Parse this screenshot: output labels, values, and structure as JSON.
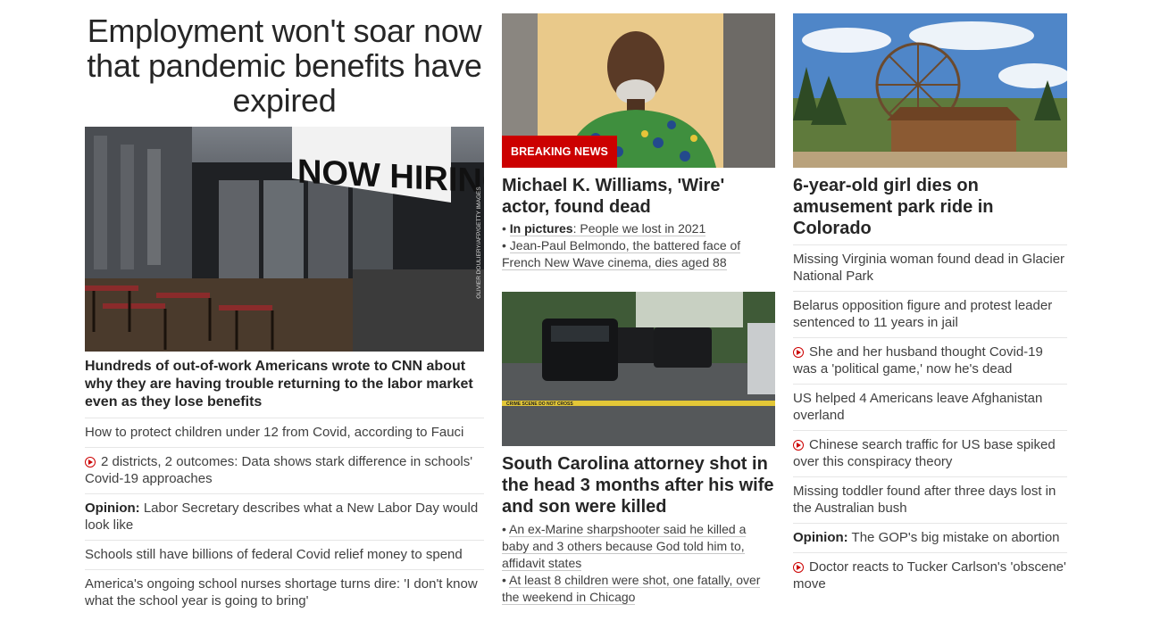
{
  "col1": {
    "headline": "Employment won't soar now that pandemic benefits have expired",
    "image_credit": "OLIVIER DOULIERY/AFP/GETTY IMAGES",
    "image_sign": "NOW HIRING",
    "caption": "Hundreds of out-of-work Americans wrote to CNN about why they are having trouble returning to the labor market even as they lose benefits",
    "items": [
      {
        "label": "",
        "text": "How to protect children under 12 from Covid, according to Fauci",
        "video": false
      },
      {
        "label": "",
        "text": "2 districts, 2 outcomes: Data shows stark difference in schools' Covid-19 approaches",
        "video": true
      },
      {
        "label": "Opinion:",
        "text": " Labor Secretary describes what a New Labor Day would look like",
        "video": false
      },
      {
        "label": "",
        "text": "Schools still have billions of federal Covid relief money to spend",
        "video": false
      },
      {
        "label": "",
        "text": "America's ongoing school nurses shortage turns dire: 'I don't know what the school year is going to bring'",
        "video": false
      }
    ]
  },
  "col2": {
    "card1": {
      "badge": "BREAKING NEWS",
      "title": "Michael K. Williams, 'Wire' actor, found dead",
      "bullets": [
        {
          "label": "In pictures",
          "text": ": People we lost in 2021"
        },
        {
          "label": "",
          "text": "Jean-Paul Belmondo, the battered face of French New Wave cinema, dies aged 88"
        }
      ]
    },
    "card2": {
      "title": "South Carolina attorney shot in the head 3 months after his wife and son were killed",
      "tape_text": "CRIME SCENE DO NOT CROSS",
      "bullets": [
        {
          "label": "",
          "text": "An ex-Marine sharpshooter said he killed a baby and 3 others because God told him to, affidavit states"
        },
        {
          "label": "",
          "text": "At least 8 children were shot, one fatally, over the weekend in Chicago"
        }
      ]
    }
  },
  "col3": {
    "title": "6-year-old girl dies on amusement park ride in Colorado",
    "items": [
      {
        "label": "",
        "text": "Missing Virginia woman found dead in Glacier National Park",
        "video": false
      },
      {
        "label": "",
        "text": "Belarus opposition figure and protest leader sentenced to 11 years in jail",
        "video": false
      },
      {
        "label": "",
        "text": "She and her husband thought Covid-19 was a 'political game,' now he's dead",
        "video": true
      },
      {
        "label": "",
        "text": "US helped 4 Americans leave Afghanistan overland",
        "video": false
      },
      {
        "label": "",
        "text": "Chinese search traffic for US base spiked over this conspiracy theory",
        "video": true
      },
      {
        "label": "",
        "text": "Missing toddler found after three days lost in the Australian bush",
        "video": false
      },
      {
        "label": "Opinion:",
        "text": " The GOP's big mistake on abortion",
        "video": false
      },
      {
        "label": "",
        "text": "Doctor reacts to Tucker Carlson's 'obscene' move",
        "video": true
      }
    ]
  },
  "colors": {
    "accent": "#cc0000",
    "text": "#262626",
    "divider": "#e6e6e6"
  }
}
